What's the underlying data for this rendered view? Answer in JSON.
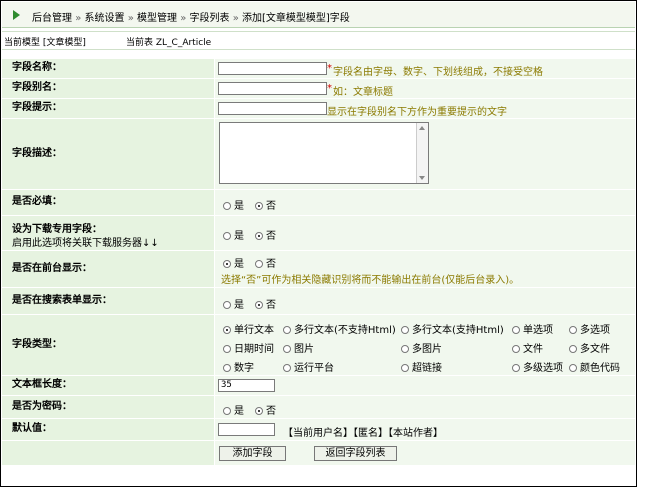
{
  "breadcrumb": [
    "后台管理",
    "系统设置",
    "模型管理",
    "字段列表",
    "添加[文章模型模型]字段"
  ],
  "breadcrumb_sep": "»",
  "model_bar": {
    "current_model": "当前模型 [文章模型]",
    "current_table": "当前表 ZL_C_Article"
  },
  "fields": {
    "name": {
      "label": "字段名称：",
      "value": "",
      "hint_star": "*",
      "hint": "字段名由字母、数字、下划线组成，不接受空格"
    },
    "alias": {
      "label": "字段别名：",
      "value": "",
      "hint_star": "*",
      "hint": " 如：文章标题"
    },
    "tip": {
      "label": "字段提示：",
      "value": "",
      "hint": "显示在字段别名下方作为重要提示的文字"
    },
    "desc": {
      "label": "字段描述："
    },
    "required": {
      "label": "是否必填：",
      "options": [
        "是",
        "否"
      ],
      "selected": 1
    },
    "download": {
      "label": "设为下载专用字段：",
      "sub": "启用此选项将关联下载服务器↓↓",
      "options": [
        "是",
        "否"
      ],
      "selected": 1
    },
    "front_show": {
      "label": "是否在前台显示：",
      "options": [
        "是",
        "否"
      ],
      "selected": 0,
      "note": "选择“否”可作为相关隐藏识别将而不能输出在前台(仅能后台录入)。"
    },
    "search_show": {
      "label": "是否在搜索表单显示：",
      "options": [
        "是",
        "否"
      ],
      "selected": 1
    },
    "type": {
      "label": "字段类型：",
      "options": [
        [
          "单行文本",
          "多行文本(不支持Html)",
          "多行文本(支持Html)",
          "单选项",
          "多选项"
        ],
        [
          "日期时间",
          "图片",
          "多图片",
          "文件",
          "多文件"
        ],
        [
          "数字",
          "运行平台",
          "超链接",
          "多级选项",
          "颜色代码"
        ]
      ],
      "selected": "单行文本"
    },
    "length": {
      "label": "文本框长度：",
      "value": "35"
    },
    "password": {
      "label": "是否为密码：",
      "options": [
        "是",
        "否"
      ],
      "selected": 1
    },
    "default": {
      "label": "默认值：",
      "value": "",
      "tags": "【当前用户名】【匿名】【本站作者】"
    }
  },
  "buttons": {
    "add": "添加字段",
    "back": "返回字段列表"
  },
  "colors": {
    "label_bg": "#e6f3e0",
    "value_bg": "#f1f8ee",
    "hint_red": "#d00000",
    "hint_olive": "#8b7a00",
    "accent": "#2e8b2e"
  }
}
